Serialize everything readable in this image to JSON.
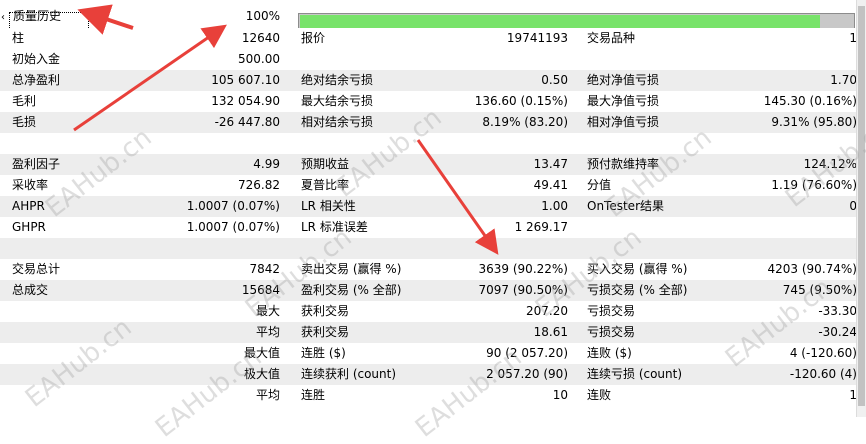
{
  "history": {
    "label": "质量历史",
    "percent_text": "100%",
    "progress": 0.94
  },
  "rows": [
    {
      "style": "white",
      "cells": [
        [
          "柱",
          "12640"
        ],
        [
          "报价",
          "19741193"
        ],
        [
          "交易品种",
          "1"
        ]
      ]
    },
    {
      "style": "white",
      "cells": [
        [
          "初始入金",
          "500.00"
        ],
        [
          "",
          ""
        ],
        [
          "",
          ""
        ]
      ]
    },
    {
      "style": "shaded",
      "cells": [
        [
          "总净盈利",
          "105 607.10"
        ],
        [
          "绝对结余亏损",
          "0.50"
        ],
        [
          "绝对净值亏损",
          "1.70"
        ]
      ]
    },
    {
      "style": "white",
      "cells": [
        [
          "毛利",
          "132 054.90"
        ],
        [
          "最大结余亏损",
          "136.60 (0.15%)"
        ],
        [
          "最大净值亏损",
          "145.30 (0.16%)"
        ]
      ]
    },
    {
      "style": "shaded",
      "cells": [
        [
          "毛损",
          "-26 447.80"
        ],
        [
          "相对结余亏损",
          "8.19% (83.20)"
        ],
        [
          "相对净值亏损",
          "9.31% (95.80)"
        ]
      ]
    },
    {
      "style": "white",
      "cells": [
        [
          "",
          ""
        ],
        [
          "",
          ""
        ],
        [
          "",
          ""
        ]
      ]
    },
    {
      "style": "shaded",
      "cells": [
        [
          "盈利因子",
          "4.99"
        ],
        [
          "预期收益",
          "13.47"
        ],
        [
          "预付款维持率",
          "124.12%"
        ]
      ]
    },
    {
      "style": "white",
      "cells": [
        [
          "采收率",
          "726.82"
        ],
        [
          "夏普比率",
          "49.41"
        ],
        [
          "分值",
          "1.19 (76.60%)"
        ]
      ]
    },
    {
      "style": "shaded",
      "cells": [
        [
          "AHPR",
          "1.0007 (0.07%)"
        ],
        [
          "LR 相关性",
          "1.00"
        ],
        [
          "OnTester结果",
          "0"
        ]
      ]
    },
    {
      "style": "white",
      "cells": [
        [
          "GHPR",
          "1.0007 (0.07%)"
        ],
        [
          "LR 标准误差",
          "1 269.17"
        ],
        [
          "",
          ""
        ]
      ]
    },
    {
      "style": "shaded",
      "cells": [
        [
          "",
          ""
        ],
        [
          "",
          ""
        ],
        [
          "",
          ""
        ]
      ]
    },
    {
      "style": "white",
      "cells": [
        [
          "交易总计",
          "7842"
        ],
        [
          "卖出交易 (赢得 %)",
          "3639 (90.22%)"
        ],
        [
          "买入交易 (赢得 %)",
          "4203 (90.74%)"
        ]
      ]
    },
    {
      "style": "shaded",
      "cells": [
        [
          "总成交",
          "15684"
        ],
        [
          "盈利交易 (% 全部)",
          "7097 (90.50%)"
        ],
        [
          "亏损交易 (% 全部)",
          "745 (9.50%)"
        ]
      ]
    },
    {
      "style": "white",
      "cells": [
        [
          "",
          "最大"
        ],
        [
          "获利交易",
          "207.20"
        ],
        [
          "亏损交易",
          "-33.30"
        ]
      ]
    },
    {
      "style": "shaded",
      "cells": [
        [
          "",
          "平均"
        ],
        [
          "获利交易",
          "18.61"
        ],
        [
          "亏损交易",
          "-30.24"
        ]
      ]
    },
    {
      "style": "white",
      "cells": [
        [
          "",
          "最大值"
        ],
        [
          "连胜 ($)",
          "90 (2 057.20)"
        ],
        [
          "连败 ($)",
          "4 (-120.60)"
        ]
      ]
    },
    {
      "style": "shaded",
      "cells": [
        [
          "",
          "极大值"
        ],
        [
          "连续获利 (count)",
          "2 057.20 (90)"
        ],
        [
          "连续亏损 (count)",
          "-120.60 (4)"
        ]
      ]
    },
    {
      "style": "white",
      "cells": [
        [
          "",
          "平均"
        ],
        [
          "连胜",
          "10"
        ],
        [
          "连败",
          "1"
        ]
      ]
    }
  ],
  "watermark": "EAHub.cn",
  "colors": {
    "progress_fill": "#78e36a",
    "shaded_row": "#ededed",
    "arrow": "#e8403a"
  }
}
